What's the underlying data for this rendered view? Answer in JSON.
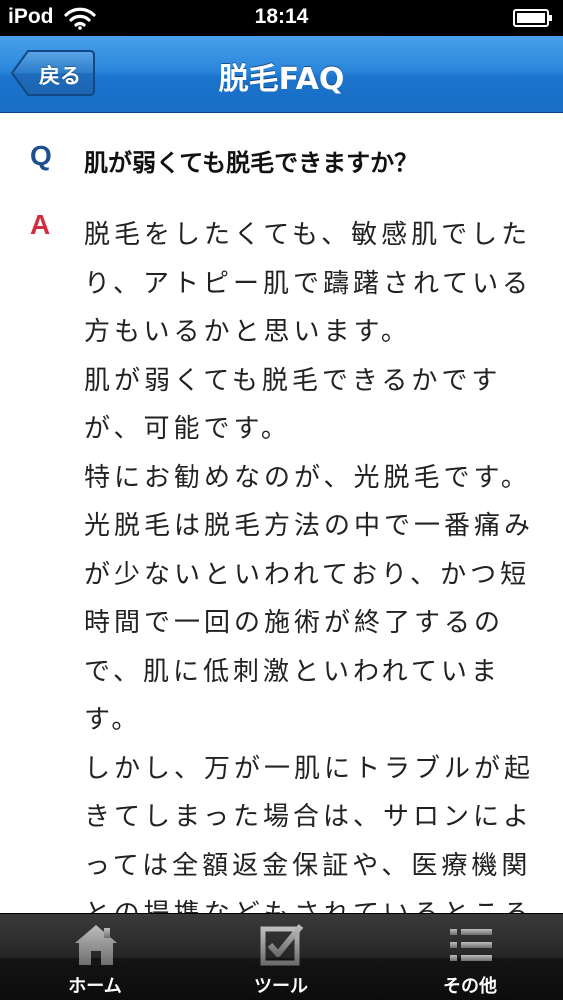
{
  "status_bar": {
    "device": "iPod",
    "time": "18:14"
  },
  "nav": {
    "back_label": "戻る",
    "title": "脱毛FAQ"
  },
  "faq": {
    "q_marker": "Q",
    "question": "肌が弱くても脱毛できますか？",
    "a_marker": "A",
    "answer": "脱毛をしたくても、敏感肌でしたり、アトピー肌で躊躇されている方もいるかと思います。\n肌が弱くても脱毛できるかですが、可能です。\n特にお勧めなのが、光脱毛です。\n光脱毛は脱毛方法の中で一番痛みが少ないといわれており、かつ短時間で一回の施術が終了するので、肌に低刺激といわれています。\nしかし、万が一肌にトラブルが起きてしまった場合は、サロンによっては全額返金保証や、医療機関との提携などもされているところも"
  },
  "tabs": [
    {
      "label": "ホーム",
      "icon": "home-icon"
    },
    {
      "label": "ツール",
      "icon": "checkbox-icon"
    },
    {
      "label": "その他",
      "icon": "list-icon"
    }
  ],
  "colors": {
    "nav_blue": "#2a86dc",
    "q_color": "#1d4e8f",
    "a_color": "#d32c3c",
    "tabbar": "#1c1c1c"
  }
}
